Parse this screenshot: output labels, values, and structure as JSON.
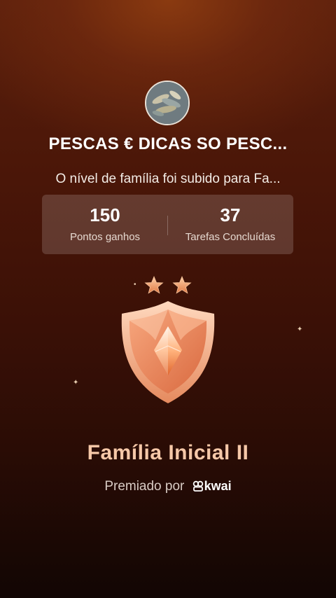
{
  "group": {
    "name": "PESCAS € DICAS SO PESC...",
    "avatar_icon": "fish-photo-avatar"
  },
  "message": "O nível de família foi subido para Fa...",
  "stats": [
    {
      "value": "150",
      "label": "Pontos ganhos"
    },
    {
      "value": "37",
      "label": "Tarefas Concluídas"
    }
  ],
  "badge": {
    "stars_count": 2,
    "icon": "shield-badge-icon",
    "colors": {
      "shield": "#f0a27a",
      "star": "#f2a072"
    }
  },
  "level_name": "Família Inicial II",
  "awarded_by": {
    "prefix": "Premiado por",
    "brand": "kwai"
  },
  "colors": {
    "level_text": "#f6c8a8",
    "background_top": "#5a1f0c",
    "background_bottom": "#120604"
  }
}
